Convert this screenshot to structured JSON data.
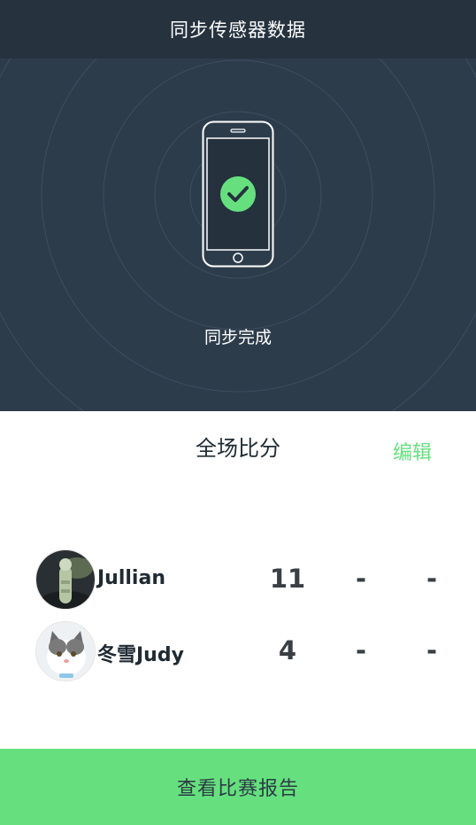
{
  "header": {
    "title": "同步传感器数据"
  },
  "sync": {
    "status_text": "同步完成",
    "status_icon": "check-circle-icon",
    "accent_color": "#66e07f"
  },
  "score_section": {
    "title": "全场比分",
    "edit_label": "编辑"
  },
  "players": [
    {
      "name": "Jullian",
      "avatar_icon": "cactus-avatar",
      "scores": [
        "11",
        "-",
        "-"
      ]
    },
    {
      "name": "冬雪Judy",
      "avatar_icon": "cat-avatar",
      "scores": [
        "4",
        "-",
        "-"
      ]
    }
  ],
  "footer": {
    "button_label": "查看比赛报告"
  },
  "colors": {
    "top_background": "#2d3c4b",
    "navbar": "#26323e",
    "accent": "#66e07f"
  }
}
